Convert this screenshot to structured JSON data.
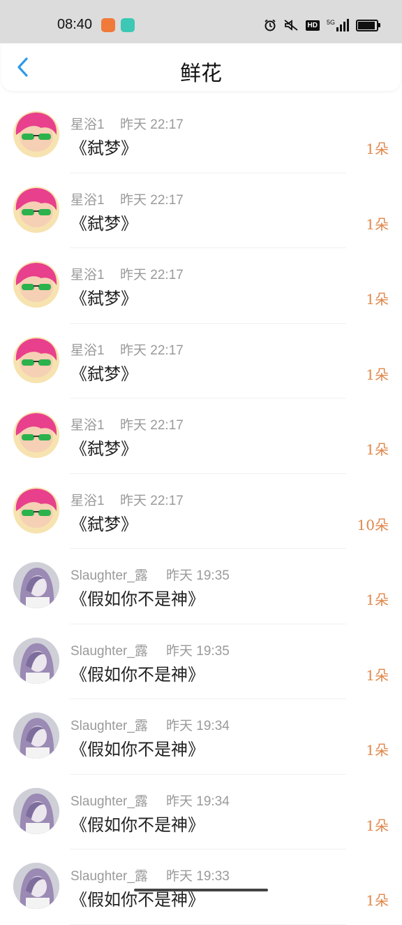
{
  "status_bar": {
    "time": "08:40",
    "icons": [
      "app-notification-icon",
      "chat-app-icon",
      "alarm-icon",
      "mute-icon",
      "hd-icon",
      "5g-signal-icon",
      "battery-icon"
    ],
    "hd_label": "HD",
    "network_label": "5G"
  },
  "header": {
    "title": "鲜花",
    "back_icon": "chevron-left-icon",
    "accent_color": "#2f9be6"
  },
  "colors": {
    "count": "#e0874a",
    "meta": "#9a9a9a"
  },
  "list": {
    "items": [
      {
        "user": "星浴1",
        "time": "昨天 22:17",
        "title": "《弑梦》",
        "count": "1朵"
      },
      {
        "user": "星浴1",
        "time": "昨天 22:17",
        "title": "《弑梦》",
        "count": "1朵"
      },
      {
        "user": "星浴1",
        "time": "昨天 22:17",
        "title": "《弑梦》",
        "count": "1朵"
      },
      {
        "user": "星浴1",
        "time": "昨天 22:17",
        "title": "《弑梦》",
        "count": "1朵"
      },
      {
        "user": "星浴1",
        "time": "昨天 22:17",
        "title": "《弑梦》",
        "count": "1朵"
      },
      {
        "user": "星浴1",
        "time": "昨天 22:17",
        "title": "《弑梦》",
        "count": "10朵"
      },
      {
        "user": "Slaughter_露",
        "time": "昨天 19:35",
        "title": "《假如你不是神》",
        "count": "1朵"
      },
      {
        "user": "Slaughter_露",
        "time": "昨天 19:35",
        "title": "《假如你不是神》",
        "count": "1朵"
      },
      {
        "user": "Slaughter_露",
        "time": "昨天 19:34",
        "title": "《假如你不是神》",
        "count": "1朵"
      },
      {
        "user": "Slaughter_露",
        "time": "昨天 19:34",
        "title": "《假如你不是神》",
        "count": "1朵"
      },
      {
        "user": "Slaughter_露",
        "time": "昨天 19:33",
        "title": "《假如你不是神》",
        "count": "1朵"
      }
    ]
  }
}
